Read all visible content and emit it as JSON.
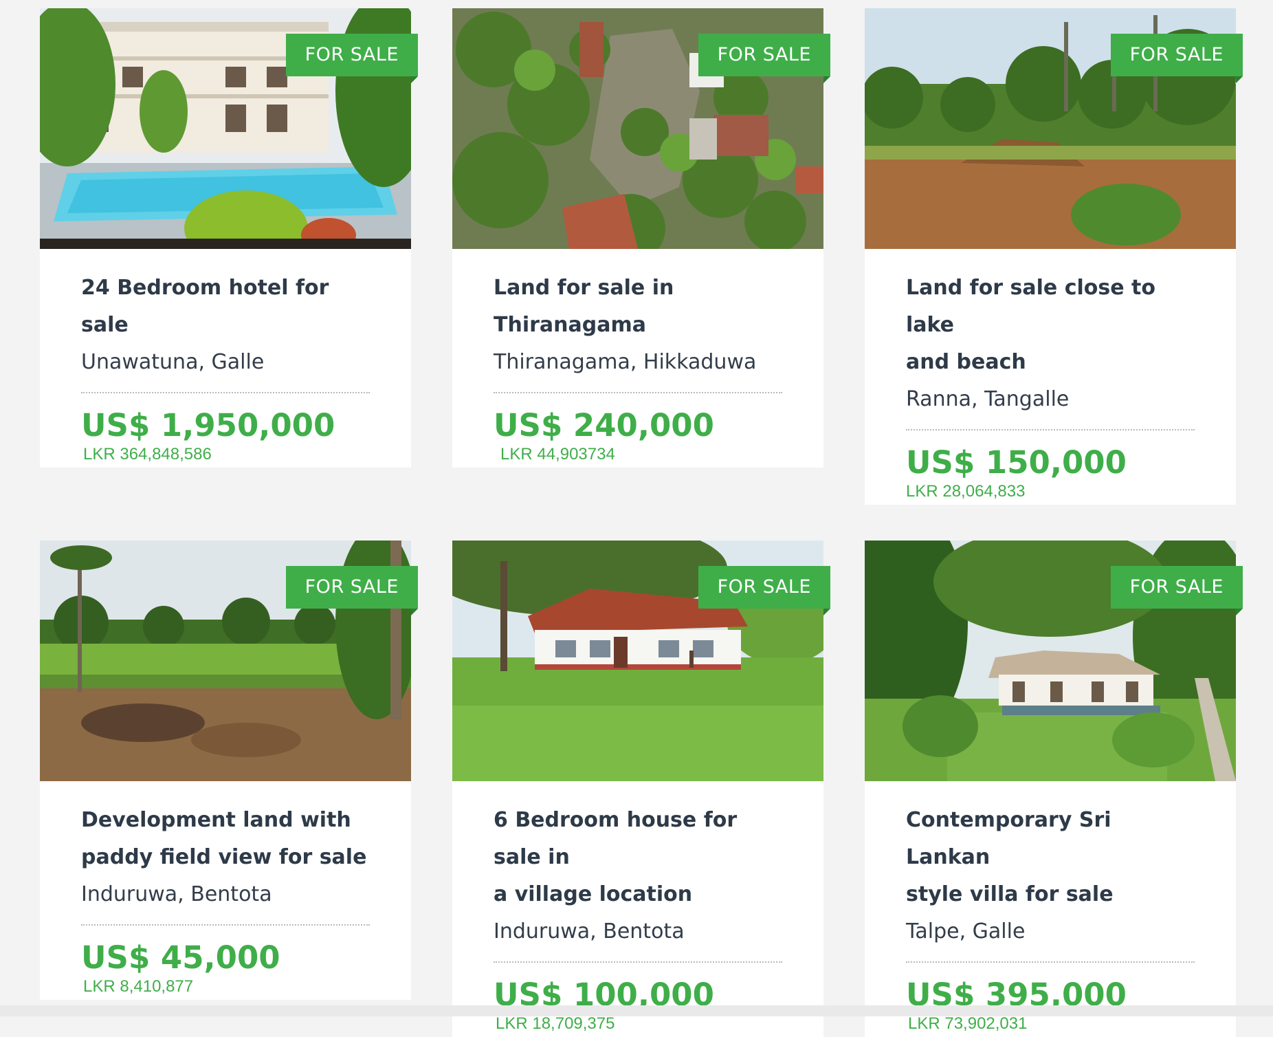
{
  "listings": [
    {
      "badge": "FOR SALE",
      "title_lines": [
        "24 Bedroom hotel for sale"
      ],
      "location": "Unawatuna, Galle",
      "price_usd": "US$ 1,950,000",
      "price_lkr": "LKR 364,848,586",
      "image": "hotel-with-pool-photo"
    },
    {
      "badge": "FOR SALE",
      "title_lines": [
        "Land for sale in",
        "Thiranagama"
      ],
      "location": "Thiranagama, Hikkaduwa",
      "price_usd": "US$ 240,000",
      "price_lkr": "LKR 44,903734",
      "image": "aerial-land-photo"
    },
    {
      "badge": "FOR SALE",
      "title_lines": [
        "Land for sale close to lake",
        "and beach"
      ],
      "location": "Ranna, Tangalle",
      "price_usd": "US$ 150,000",
      "price_lkr": "LKR 28,064,833",
      "image": "cleared-land-photo"
    },
    {
      "badge": "FOR SALE",
      "title_lines": [
        "Development land with",
        "paddy field view for sale"
      ],
      "location": "Induruwa, Bentota",
      "price_usd": "US$ 45,000",
      "price_lkr": "LKR 8,410,877",
      "image": "paddy-field-land-photo"
    },
    {
      "badge": "FOR SALE",
      "title_lines": [
        "6 Bedroom house for sale in",
        "a village location"
      ],
      "location": "Induruwa, Bentota",
      "price_usd": "US$ 100,000",
      "price_lkr": "LKR 18,709,375",
      "image": "village-house-photo"
    },
    {
      "badge": "FOR SALE",
      "title_lines": [
        "Contemporary Sri Lankan",
        "style villa for sale"
      ],
      "location": "Talpe, Galle",
      "price_usd": "US$ 395,000",
      "price_lkr": "LKR 73,902,031",
      "image": "villa-garden-photo"
    }
  ],
  "colors": {
    "accent": "#3fae49",
    "title": "#2e3a48",
    "background": "#f3f3f3"
  }
}
